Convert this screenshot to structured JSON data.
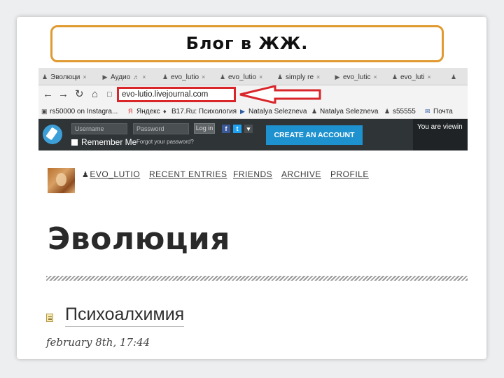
{
  "slide": {
    "title": "Блог в ЖЖ.",
    "colors": {
      "title_border": "#e09a2f",
      "highlight": "#d9262b"
    }
  },
  "browser": {
    "tabs": [
      {
        "icon": "user-icon",
        "label": "Эволюци"
      },
      {
        "icon": "play-icon",
        "label": "Аудио"
      },
      {
        "icon": "user-icon",
        "label": "evo_lutio"
      },
      {
        "icon": "user-icon",
        "label": "evo_lutio"
      },
      {
        "icon": "user-icon",
        "label": "simply re"
      },
      {
        "icon": "play-icon",
        "label": "evo_lutic"
      },
      {
        "icon": "user-icon",
        "label": "evo_luti"
      }
    ],
    "url": "evo-lutio.livejournal.com",
    "bookmarks": [
      {
        "icon": "instagram-icon",
        "label": "rs50000 on Instagra..."
      },
      {
        "icon": "yandex-icon",
        "label": "Яндекс"
      },
      {
        "icon": "folder-icon",
        "label": "B17.Ru: Психология"
      },
      {
        "icon": "play-icon",
        "label": "Natalya Selezneva"
      },
      {
        "icon": "user-icon",
        "label": "Natalya Selezneva"
      },
      {
        "icon": "user-icon",
        "label": "s55555"
      },
      {
        "icon": "mail-icon",
        "label": "Почта"
      }
    ]
  },
  "lj_bar": {
    "username_placeholder": "Username",
    "password_placeholder": "Password",
    "login_label": "Log in",
    "remember_label": "Remember Me",
    "forgot_label": "Forgot your password?",
    "create_account_label": "CREATE AN ACCOUNT",
    "right_text": "You are viewin",
    "colors": {
      "bar": "#2f3437",
      "create": "#1e91cf",
      "logo": "#3d9fd8"
    }
  },
  "journal": {
    "nav": [
      "EVO_LUTIO",
      "RECENT ENTRIES",
      "FRIENDS",
      "ARCHIVE",
      "PROFILE"
    ],
    "title": "Эволюция",
    "entry": {
      "title": "Психоалхимия",
      "date": "february 8th, 17:44"
    }
  }
}
